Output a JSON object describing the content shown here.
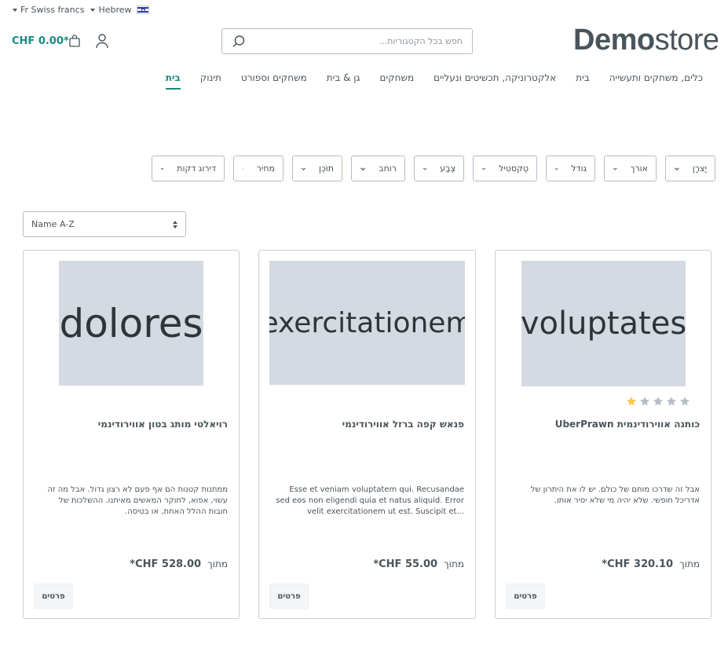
{
  "topbar": {
    "currency": "Fr Swiss francs",
    "language": "Hebrew"
  },
  "header": {
    "cart_total": "CHF 0.00*",
    "search_placeholder": "חפש בכל הקטגוריות...",
    "logo_bold": "Demo",
    "logo_light": "store"
  },
  "nav": {
    "items": [
      {
        "label": "בית",
        "active": true
      },
      {
        "label": "תינוק"
      },
      {
        "label": "משחקים וספורט"
      },
      {
        "label": "גן & בית"
      },
      {
        "label": "משחקים"
      },
      {
        "label": "אלקטרוניקה, תכשיטים ונעליים"
      },
      {
        "label": "בית"
      },
      {
        "label": "כלים, משחקים ותעשייה"
      }
    ]
  },
  "filters": [
    {
      "label": "יַצרָן"
    },
    {
      "label": "אורך"
    },
    {
      "label": "גודל"
    },
    {
      "label": "טֶקסטִיל"
    },
    {
      "label": "צֶבַע"
    },
    {
      "label": "רוחב"
    },
    {
      "label": "תוֹכֶן"
    },
    {
      "label": "מחיר"
    },
    {
      "label": "דירוג דקות"
    }
  ],
  "sort": {
    "selected": "Name A-Z"
  },
  "products": [
    {
      "image_text": "voluptates",
      "title": "כותנה אווירודינמית UberPrawn",
      "rating": 1,
      "description": "אבל זה שדרכו מוחם של כולם. יש לו את היתרון של אדריכל חופשי. שלא יהיה מי שלא יסיר אותו.",
      "from_label": "מתוך",
      "price": "CHF 320.10*",
      "button": "פרטים"
    },
    {
      "image_text": "exercitationem",
      "title": "פנאש קפה ברזל אווירודינמי",
      "description": "Esse et veniam voluptatem qui. Recusandae sed eos non eligendi quia et natus aliquid. Error velit exercitationem ut est. Suscipit et...",
      "from_label": "מתוך",
      "price": "CHF 55.00*",
      "button": "פרטים"
    },
    {
      "image_text": "dolores",
      "title": "רויאלטי מותג בטון אווירודינמי",
      "description": "ממתנות קטנות הם אף פעם לא רצון גדול. אבל מה זה עשוי, אפוא, לחוקר המאשים מאיתנו. ההשלכות של חובות ההלל האחת, או בטיסה.",
      "from_label": "מתוך",
      "price": "CHF 528.00*",
      "button": "פרטים"
    }
  ],
  "colors": {
    "accent": "#1a8a82",
    "text": "#4a545b",
    "border": "#b3bdc8",
    "image_bg": "#d5dae2",
    "star_filled": "#ffc94d",
    "star_empty": "#b7bec7"
  }
}
